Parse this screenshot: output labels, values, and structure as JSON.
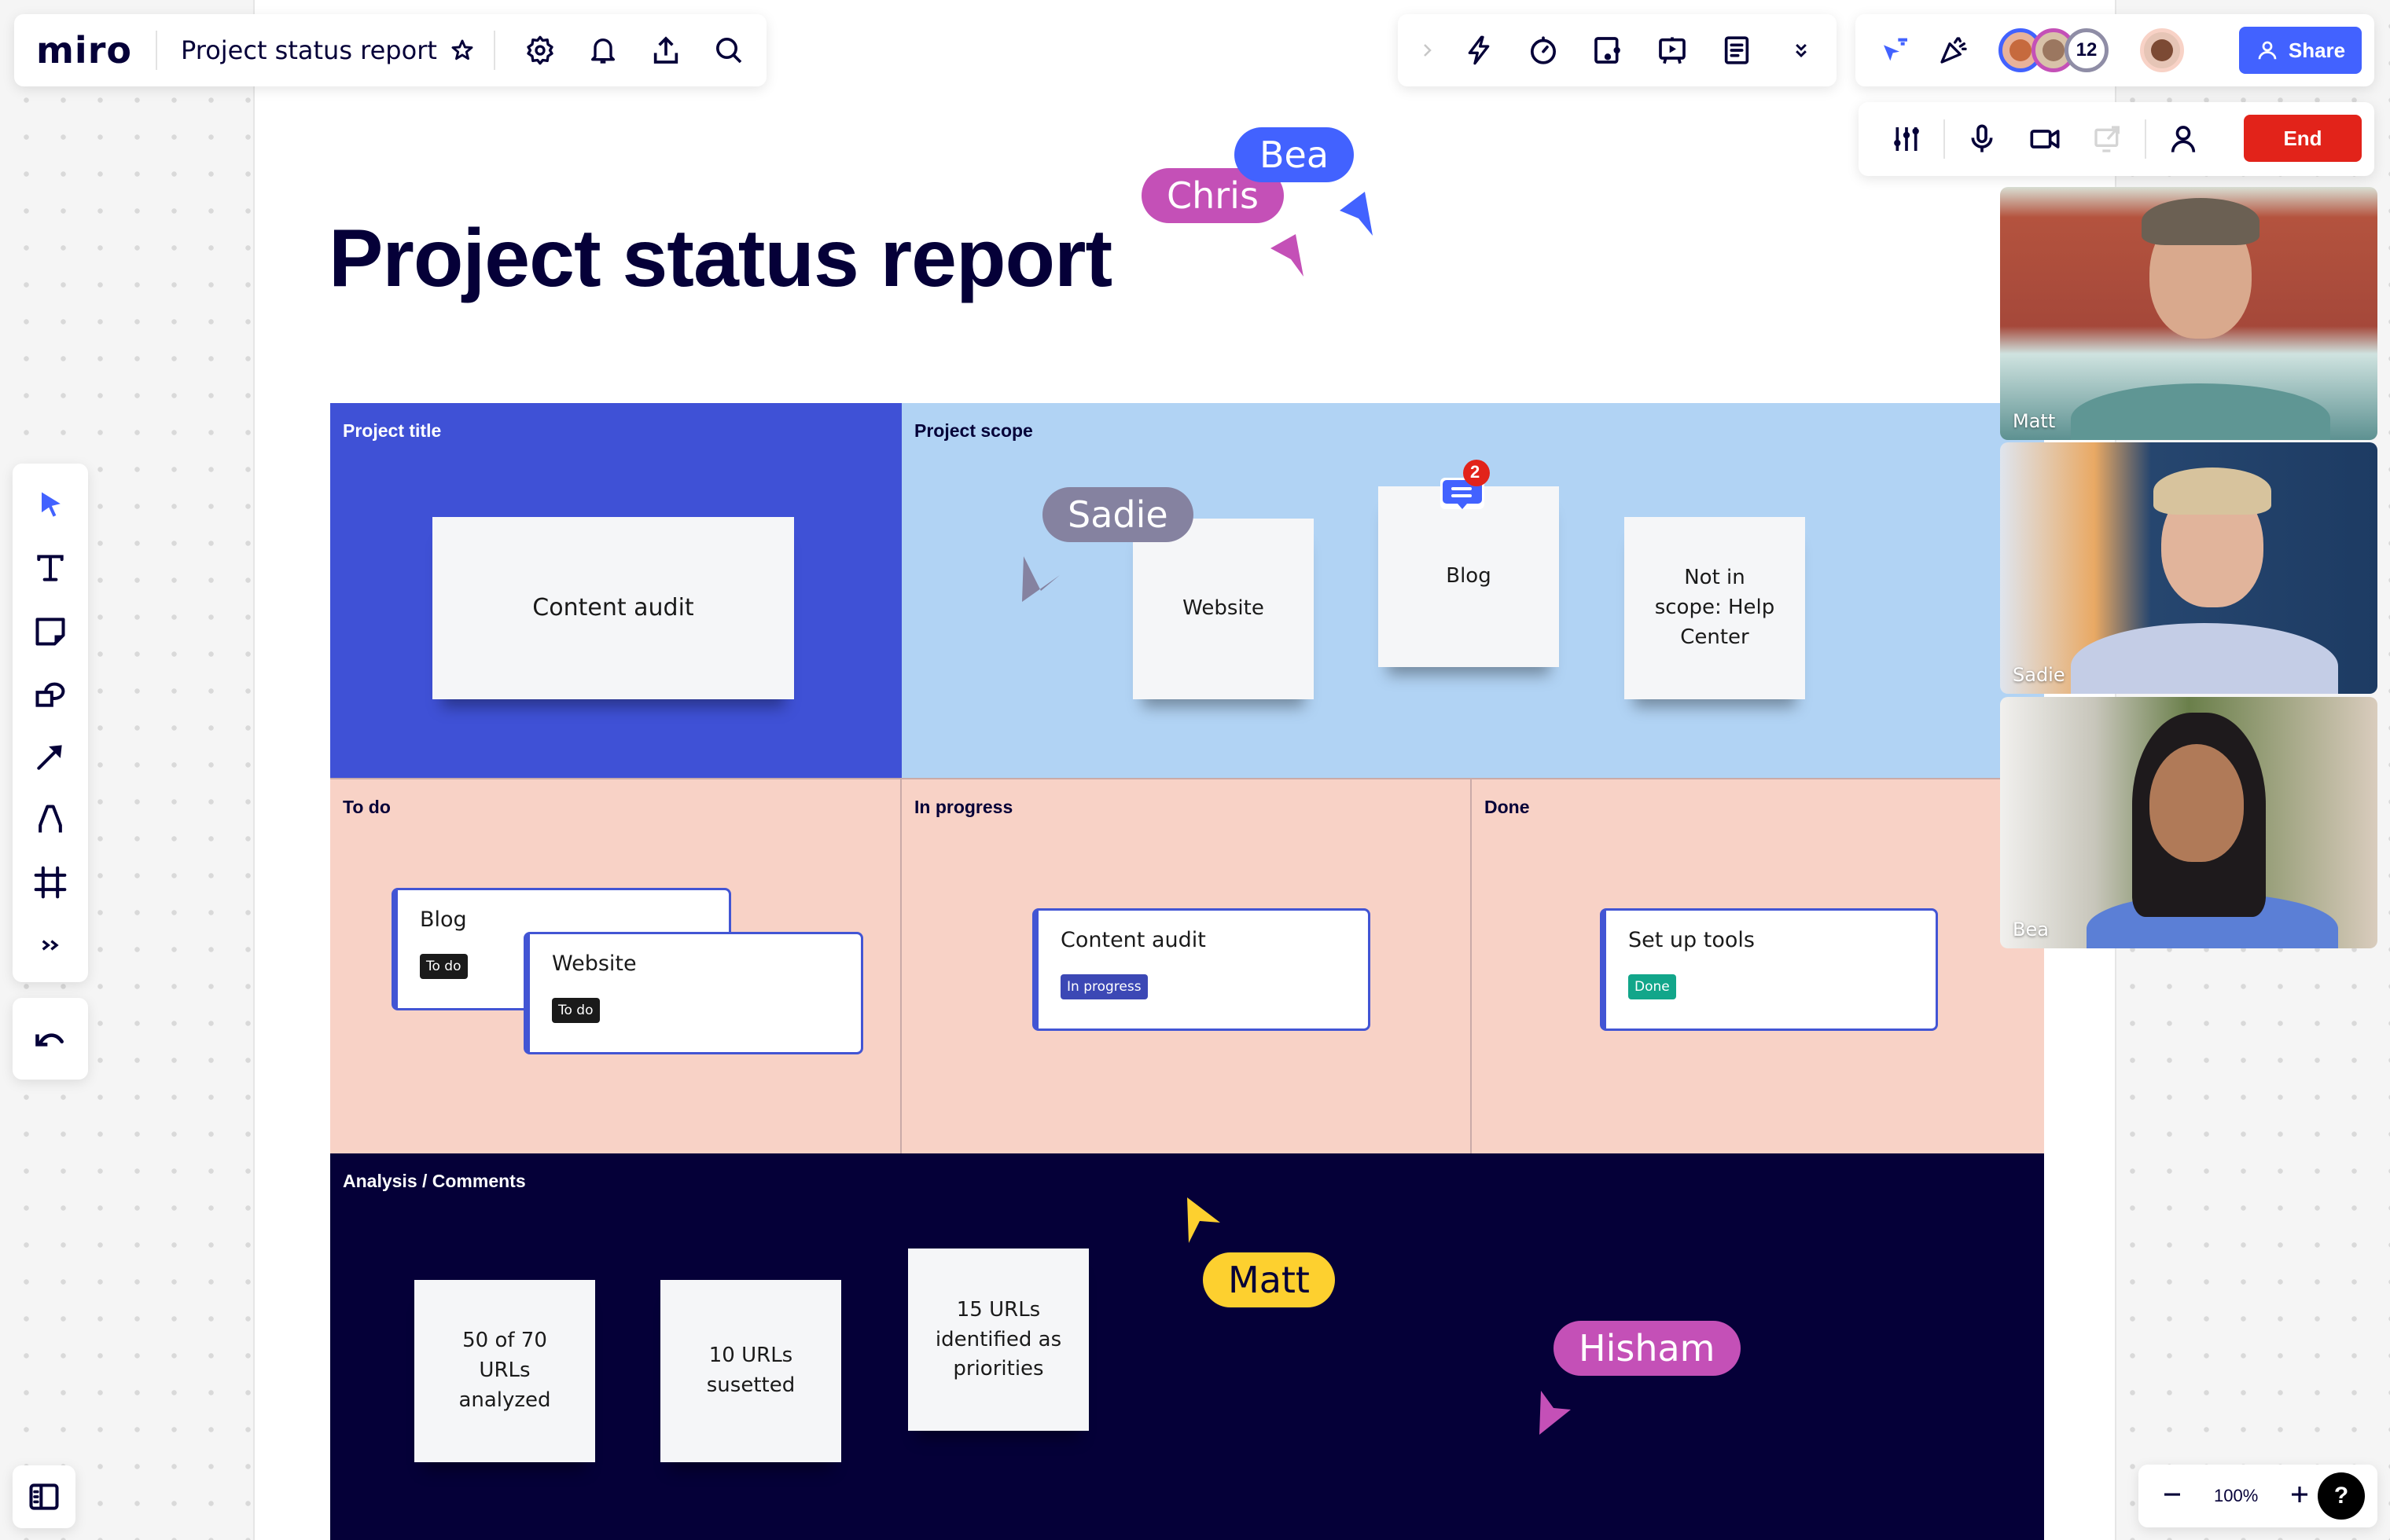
{
  "app": {
    "logo": "miro",
    "board_title": "Project status report"
  },
  "topbar": {
    "left_icons": [
      "star-icon",
      "settings-icon",
      "bell-icon",
      "export-icon",
      "search-icon"
    ],
    "tool_icons": [
      "chevron-right-icon",
      "lightning-icon",
      "timer-icon",
      "card-icon",
      "presentation-icon",
      "notes-icon",
      "chevron-double-down-icon"
    ],
    "collab": {
      "avatar_overflow_count": "12",
      "share_label": "Share",
      "colors": {
        "share": "#4262ff",
        "avatar1": "#4262ff",
        "avatar2": "#c450b7",
        "avatar3": "#8f8da6"
      }
    }
  },
  "call_bar": {
    "icons": [
      "sliders-icon",
      "microphone-icon",
      "camera-icon",
      "screen-share-icon",
      "person-icon"
    ],
    "end_label": "End",
    "end_color": "#e2231a"
  },
  "left_toolbar": {
    "tools": [
      "select-icon",
      "text-icon",
      "sticky-note-icon",
      "shapes-icon",
      "arrow-icon",
      "pen-icon",
      "frame-icon",
      "more-tools-icon"
    ],
    "undo": "undo-icon"
  },
  "zoom": {
    "level": "100%",
    "help": "?"
  },
  "canvas": {
    "title": "Project status report",
    "sections": {
      "project_title": {
        "label": "Project title",
        "stickies": [
          "Content audit"
        ]
      },
      "project_scope": {
        "label": "Project scope",
        "stickies": [
          "Website",
          "Blog",
          "Not in scope: Help Center"
        ],
        "comment_count": "2"
      },
      "todo": {
        "label": "To do",
        "cards": [
          {
            "title": "Blog",
            "tag": "To do"
          },
          {
            "title": "Website",
            "tag": "To do"
          }
        ]
      },
      "in_progress": {
        "label": "In progress",
        "cards": [
          {
            "title": "Content audit",
            "tag": "In progress"
          }
        ]
      },
      "done": {
        "label": "Done",
        "cards": [
          {
            "title": "Set up tools",
            "tag": "Done"
          }
        ]
      },
      "analysis": {
        "label": "Analysis / Comments",
        "stickies": [
          "50 of 70 URLs analyzed",
          "10 URLs susetted",
          "15 URLs identified as priorities"
        ]
      }
    },
    "colors": {
      "project_title_bg": "#3f51d6",
      "project_scope_bg": "#b1d3f4",
      "status_bg": "#f8d2c6",
      "analysis_bg": "#050038",
      "tag_todo": "#1a1a1a",
      "tag_progress": "#3c48b5",
      "tag_done": "#12a68a"
    },
    "cursors": [
      {
        "name": "Chris",
        "color": "#c450b7"
      },
      {
        "name": "Bea",
        "color": "#4262ff"
      },
      {
        "name": "Sadie",
        "color": "#8582a0"
      },
      {
        "name": "Matt",
        "color": "#fdd02f"
      },
      {
        "name": "Hisham",
        "color": "#c450b7"
      }
    ]
  },
  "video_participants": [
    {
      "name": "Matt"
    },
    {
      "name": "Sadie"
    },
    {
      "name": "Bea"
    }
  ]
}
